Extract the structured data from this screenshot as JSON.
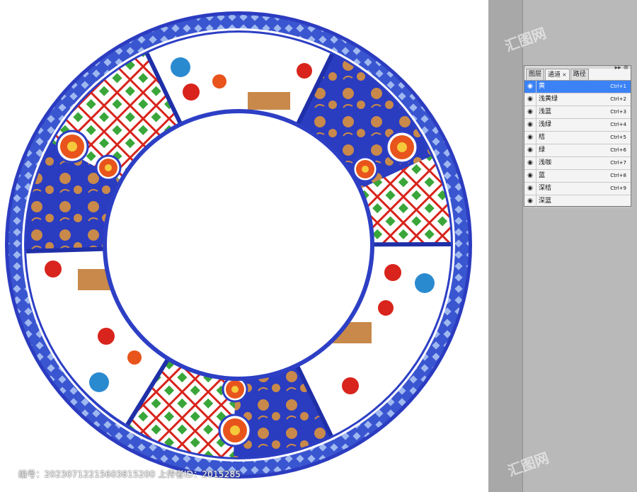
{
  "panel": {
    "tabs": [
      {
        "label": "图层"
      },
      {
        "label": "通道",
        "close": "×"
      },
      {
        "label": "路径"
      }
    ],
    "controls": "▸▸ ≡",
    "channels": [
      {
        "name": "黄",
        "shortcut": "Ctrl+1",
        "selected": true
      },
      {
        "name": "浅黄绿",
        "shortcut": "Ctrl+2"
      },
      {
        "name": "浅蓝",
        "shortcut": "Ctrl+3"
      },
      {
        "name": "浅绿",
        "shortcut": "Ctrl+4"
      },
      {
        "name": "桔",
        "shortcut": "Ctrl+5"
      },
      {
        "name": "绿",
        "shortcut": "Ctrl+6"
      },
      {
        "name": "浅咖",
        "shortcut": "Ctrl+7"
      },
      {
        "name": "蓝",
        "shortcut": "Ctrl+8"
      },
      {
        "name": "深桔",
        "shortcut": "Ctrl+9"
      },
      {
        "name": "深蓝",
        "shortcut": ""
      }
    ]
  },
  "footer": {
    "text": "编号：20230712215603815200  上传者ID：2015285"
  },
  "watermark": "汇图网",
  "colors": {
    "blue": "#2d3fc4",
    "cobalt": "#1f2fa8",
    "tan": "#c8894a",
    "orange": "#e8541c",
    "green": "#3aa63a",
    "red": "#d8241c"
  }
}
